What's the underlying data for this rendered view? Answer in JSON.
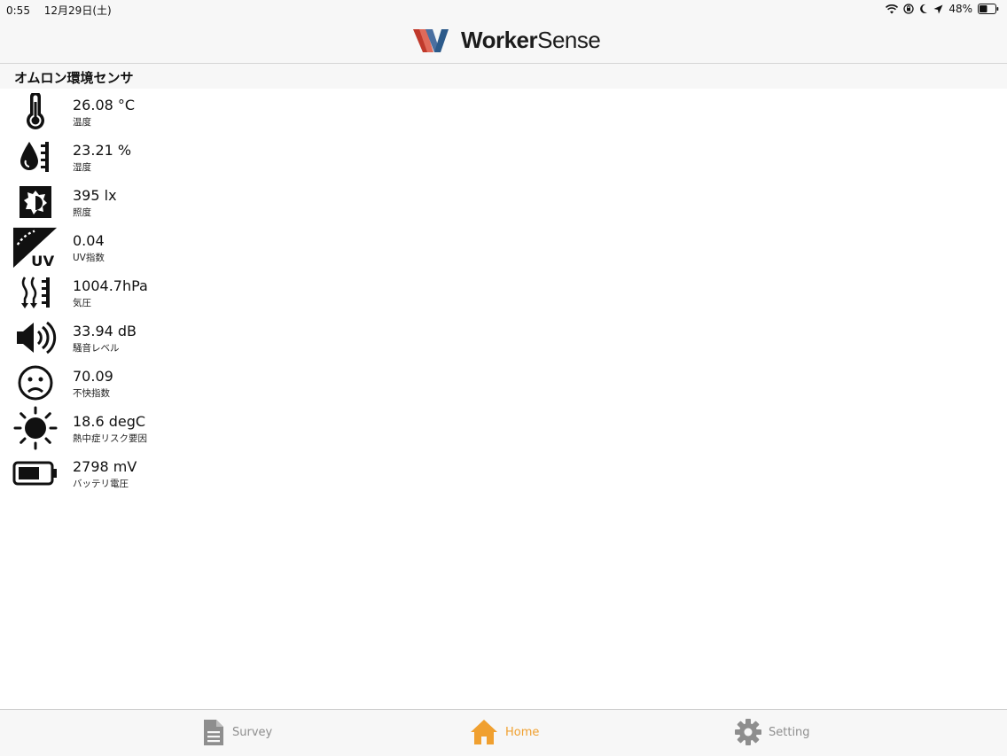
{
  "status_bar": {
    "time": "0:55",
    "date": "12月29日(土)",
    "battery": "48%"
  },
  "nav": {
    "brand_bold": "Worker",
    "brand_light": "Sense"
  },
  "section": {
    "title": "オムロン環境センサ"
  },
  "sensors": [
    {
      "value": "26.08 °C",
      "label": "温度",
      "icon": "thermometer-icon"
    },
    {
      "value": "23.21 %",
      "label": "湿度",
      "icon": "humidity-icon"
    },
    {
      "value": "395 lx",
      "label": "照度",
      "icon": "illuminance-icon"
    },
    {
      "value": "0.04",
      "label": "UV指数",
      "icon": "uv-icon"
    },
    {
      "value": "1004.7hPa",
      "label": "気圧",
      "icon": "pressure-icon"
    },
    {
      "value": "33.94 dB",
      "label": "騒音レベル",
      "icon": "speaker-icon"
    },
    {
      "value": "70.09",
      "label": "不快指数",
      "icon": "sad-face-icon"
    },
    {
      "value": "18.6 degC",
      "label": "熱中症リスク要因",
      "icon": "sun-icon"
    },
    {
      "value": "2798 mV",
      "label": "バッテリ電圧",
      "icon": "battery-icon"
    }
  ],
  "tabs": [
    {
      "label": "Survey",
      "icon": "document-icon",
      "active": false
    },
    {
      "label": "Home",
      "icon": "home-icon",
      "active": true
    },
    {
      "label": "Setting",
      "icon": "gear-icon",
      "active": false
    }
  ],
  "colors": {
    "active_tab": "#f0a030",
    "inactive_tab": "#8e8e8e",
    "logo_red": "#c0392b",
    "logo_blue": "#2c5a8a"
  }
}
